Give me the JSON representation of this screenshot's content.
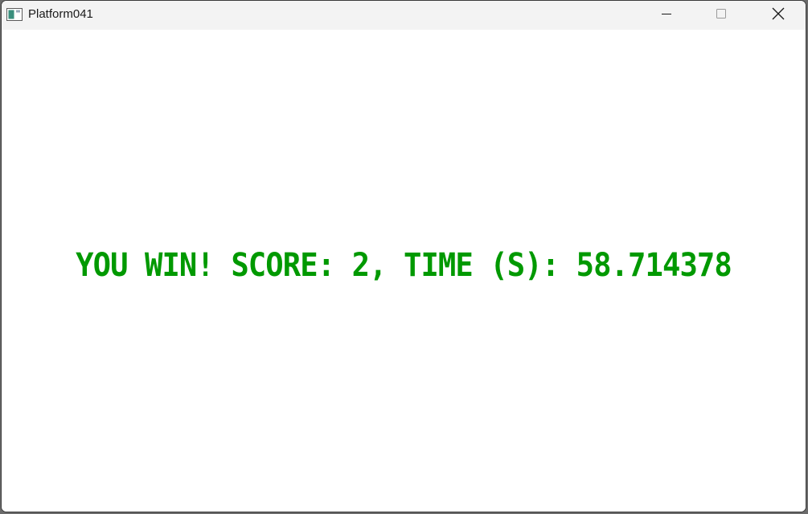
{
  "window": {
    "title": "Platform041",
    "app_icon": "console-window-icon",
    "controls": {
      "minimize_icon": "minimize-icon",
      "maximize_icon": "maximize-icon",
      "close_icon": "close-icon"
    }
  },
  "game": {
    "message": "YOU WIN! SCORE: 2, TIME (S): 58.714378",
    "message_color": "#009900"
  }
}
